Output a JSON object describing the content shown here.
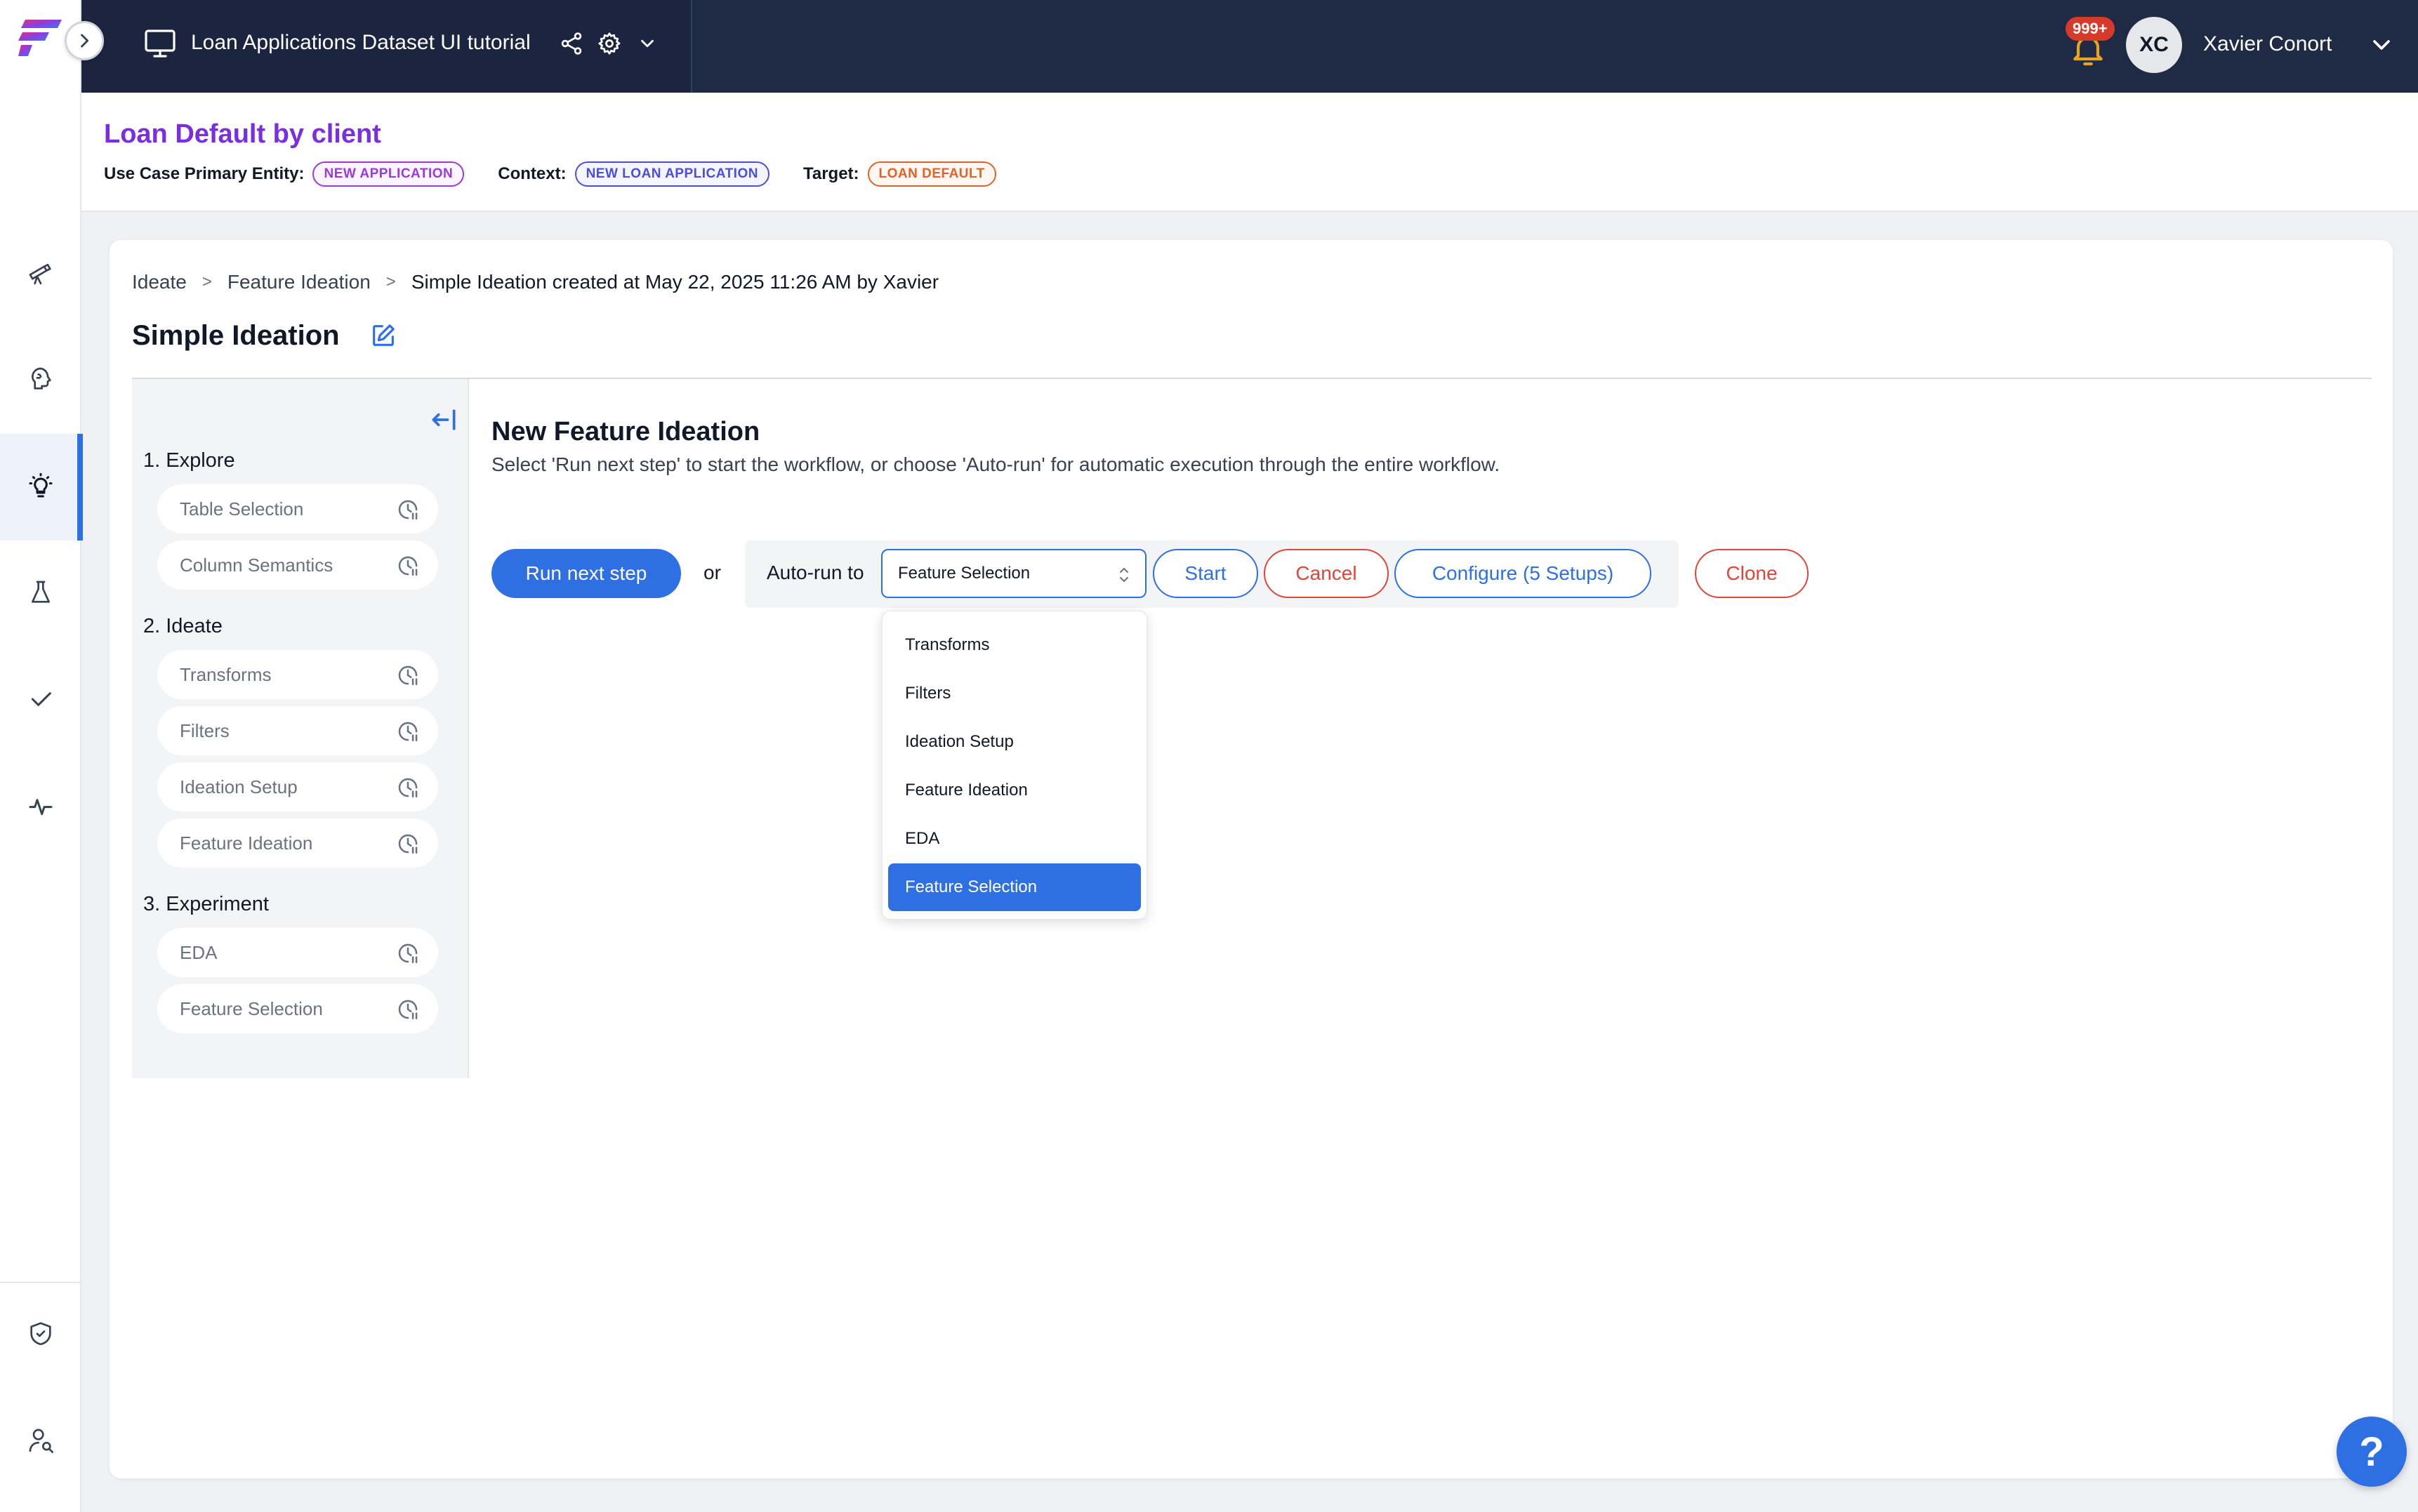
{
  "colors": {
    "topbar": "#1f2a44",
    "accent": "#2f6fe4",
    "danger": "#e0443a",
    "title_purple": "#7b2de0",
    "entity_pill": "#9b3ad8",
    "context_pill": "#4b4fd8",
    "target_pill": "#e0622a"
  },
  "rail": {
    "toggle_icon": "chevron-right-icon",
    "icons": [
      "telescope-icon",
      "brain-icon",
      "lightbulb-icon",
      "flask-icon",
      "checkmark-icon",
      "pulse-icon",
      "shield-icon",
      "user-search-icon"
    ],
    "active_icon": "lightbulb-icon"
  },
  "topbar": {
    "project_title": "Loan Applications Dataset UI tutorial",
    "notification_count": "999+",
    "avatar_initials": "XC",
    "user_name": "Xavier Conort"
  },
  "use_case": {
    "title": "Loan Default by client",
    "primary_entity_label": "Use Case Primary Entity:",
    "primary_entity": "NEW APPLICATION",
    "context_label": "Context:",
    "context": "NEW LOAN APPLICATION",
    "target_label": "Target:",
    "target": "LOAN DEFAULT"
  },
  "breadcrumb": {
    "items": [
      "Ideate",
      "Feature Ideation"
    ],
    "separator": ">",
    "current": "Simple Ideation created at May 22, 2025 11:26 AM by Xavier"
  },
  "page_title": "Simple Ideation",
  "steps": {
    "groups": [
      {
        "label": "1. Explore",
        "items": [
          "Table Selection",
          "Column Semantics"
        ]
      },
      {
        "label": "2. Ideate",
        "items": [
          "Transforms",
          "Filters",
          "Ideation Setup",
          "Feature Ideation"
        ]
      },
      {
        "label": "3. Experiment",
        "items": [
          "EDA",
          "Feature Selection"
        ]
      }
    ]
  },
  "content": {
    "title": "New Feature Ideation",
    "subtitle": "Select 'Run next step' to start the workflow, or choose 'Auto-run' for automatic execution through the entire workflow.",
    "run_next_label": "Run next step",
    "or_label": "or",
    "autorun_label": "Auto-run to",
    "selected_option": "Feature Selection",
    "start_label": "Start",
    "cancel_label": "Cancel",
    "configure_label": "Configure (5 Setups)",
    "clone_label": "Clone"
  },
  "dropdown": {
    "options": [
      "Transforms",
      "Filters",
      "Ideation Setup",
      "Feature Ideation",
      "EDA",
      "Feature Selection"
    ],
    "selected_index": 5
  },
  "help_label": "?"
}
